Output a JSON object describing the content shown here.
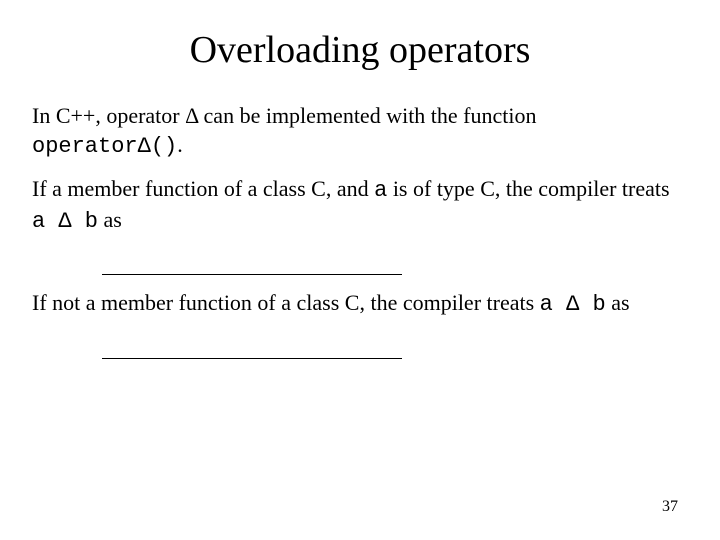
{
  "title": "Overloading operators",
  "p1_a": "In C++, operator Δ can be implemented with the function ",
  "p1_code": "operatorΔ()",
  "p1_b": ".",
  "p2_a": "If a member function of a class C, and ",
  "p2_code1": "a",
  "p2_b": " is of type C, the compiler treats ",
  "p2_code2": "a Δ b",
  "p2_c": " as",
  "p3_a": "If not a member function of a class C, the compiler treats ",
  "p3_code": "a Δ b",
  "p3_b": " as",
  "pagenum": "37"
}
